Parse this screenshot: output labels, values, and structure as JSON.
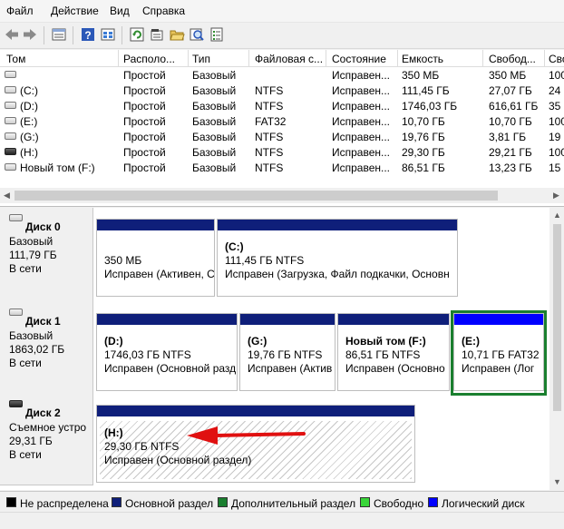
{
  "menu": [
    "Файл",
    "Действие",
    "Вид",
    "Справка"
  ],
  "toolbar": {
    "icons": [
      "back-arrow-icon",
      "forward-arrow-icon",
      "list-view-icon",
      "help-icon",
      "properties-grid-icon",
      "refresh-icon",
      "settings-icon",
      "open-folder-icon",
      "search-disk-icon",
      "tasks-icon"
    ]
  },
  "volumes": {
    "headers": [
      "Том",
      "Располо...",
      "Тип",
      "Файловая с...",
      "Состояние",
      "Емкость",
      "Свобод...",
      "Сво"
    ],
    "rows": [
      {
        "name": "",
        "layout": "Простой",
        "type": "Базовый",
        "fs": "",
        "status": "Исправен...",
        "capacity": "350 МБ",
        "free": "350 МБ",
        "pct": "100",
        "dark": false
      },
      {
        "name": "(C:)",
        "layout": "Простой",
        "type": "Базовый",
        "fs": "NTFS",
        "status": "Исправен...",
        "capacity": "111,45 ГБ",
        "free": "27,07 ГБ",
        "pct": "24",
        "dark": false
      },
      {
        "name": "(D:)",
        "layout": "Простой",
        "type": "Базовый",
        "fs": "NTFS",
        "status": "Исправен...",
        "capacity": "1746,03 ГБ",
        "free": "616,61 ГБ",
        "pct": "35",
        "dark": false
      },
      {
        "name": "(E:)",
        "layout": "Простой",
        "type": "Базовый",
        "fs": "FAT32",
        "status": "Исправен...",
        "capacity": "10,70 ГБ",
        "free": "10,70 ГБ",
        "pct": "100",
        "dark": false
      },
      {
        "name": "(G:)",
        "layout": "Простой",
        "type": "Базовый",
        "fs": "NTFS",
        "status": "Исправен...",
        "capacity": "19,76 ГБ",
        "free": "3,81 ГБ",
        "pct": "19",
        "dark": false
      },
      {
        "name": "(H:)",
        "layout": "Простой",
        "type": "Базовый",
        "fs": "NTFS",
        "status": "Исправен...",
        "capacity": "29,30 ГБ",
        "free": "29,21 ГБ",
        "pct": "100",
        "dark": true
      },
      {
        "name": "Новый том (F:)",
        "layout": "Простой",
        "type": "Базовый",
        "fs": "NTFS",
        "status": "Исправен...",
        "capacity": "86,51 ГБ",
        "free": "13,23 ГБ",
        "pct": "15",
        "dark": false
      }
    ]
  },
  "disks": [
    {
      "title": "Диск 0",
      "type": "Базовый",
      "size": "111,79 ГБ",
      "state": "В сети",
      "dark": false,
      "partitions": [
        {
          "name": "",
          "size": "350 МБ",
          "status": "Исправен (Активен, С",
          "kind": "primary"
        },
        {
          "name": "(C:)",
          "size": "111,45 ГБ NTFS",
          "status": "Исправен (Загрузка, Файл подкачки, Основн",
          "kind": "primary"
        }
      ]
    },
    {
      "title": "Диск 1",
      "type": "Базовый",
      "size": "1863,02 ГБ",
      "state": "В сети",
      "dark": false,
      "partitions": [
        {
          "name": "(D:)",
          "size": "1746,03 ГБ NTFS",
          "status": "Исправен (Основной разд",
          "kind": "primary"
        },
        {
          "name": "(G:)",
          "size": "19,76 ГБ NTFS",
          "status": "Исправен (Актив",
          "kind": "primary"
        },
        {
          "name": "Новый том  (F:)",
          "size": "86,51 ГБ NTFS",
          "status": "Исправен (Основно",
          "kind": "primary"
        },
        {
          "name": "(E:)",
          "size": "10,71 ГБ FAT32",
          "status": "Исправен (Лог",
          "kind": "logical"
        }
      ]
    },
    {
      "title": "Диск 2",
      "type": "Съемное устро",
      "size": "29,31 ГБ",
      "state": "В сети",
      "dark": true,
      "partitions": [
        {
          "name": "(H:)",
          "size": "29,30 ГБ NTFS",
          "status": "Исправен (Основной раздел)",
          "kind": "primary",
          "selected": true
        }
      ]
    }
  ],
  "legend": [
    {
      "label": "Не распределена",
      "color": "#000000"
    },
    {
      "label": "Основной раздел",
      "color": "#0f1f7a"
    },
    {
      "label": "Дополнительный раздел",
      "color": "#1a7f2f"
    },
    {
      "label": "Свободно",
      "color": "#39d639"
    },
    {
      "label": "Логический диск",
      "color": "#0000ff"
    }
  ],
  "annotation_arrow_color": "#e01010"
}
